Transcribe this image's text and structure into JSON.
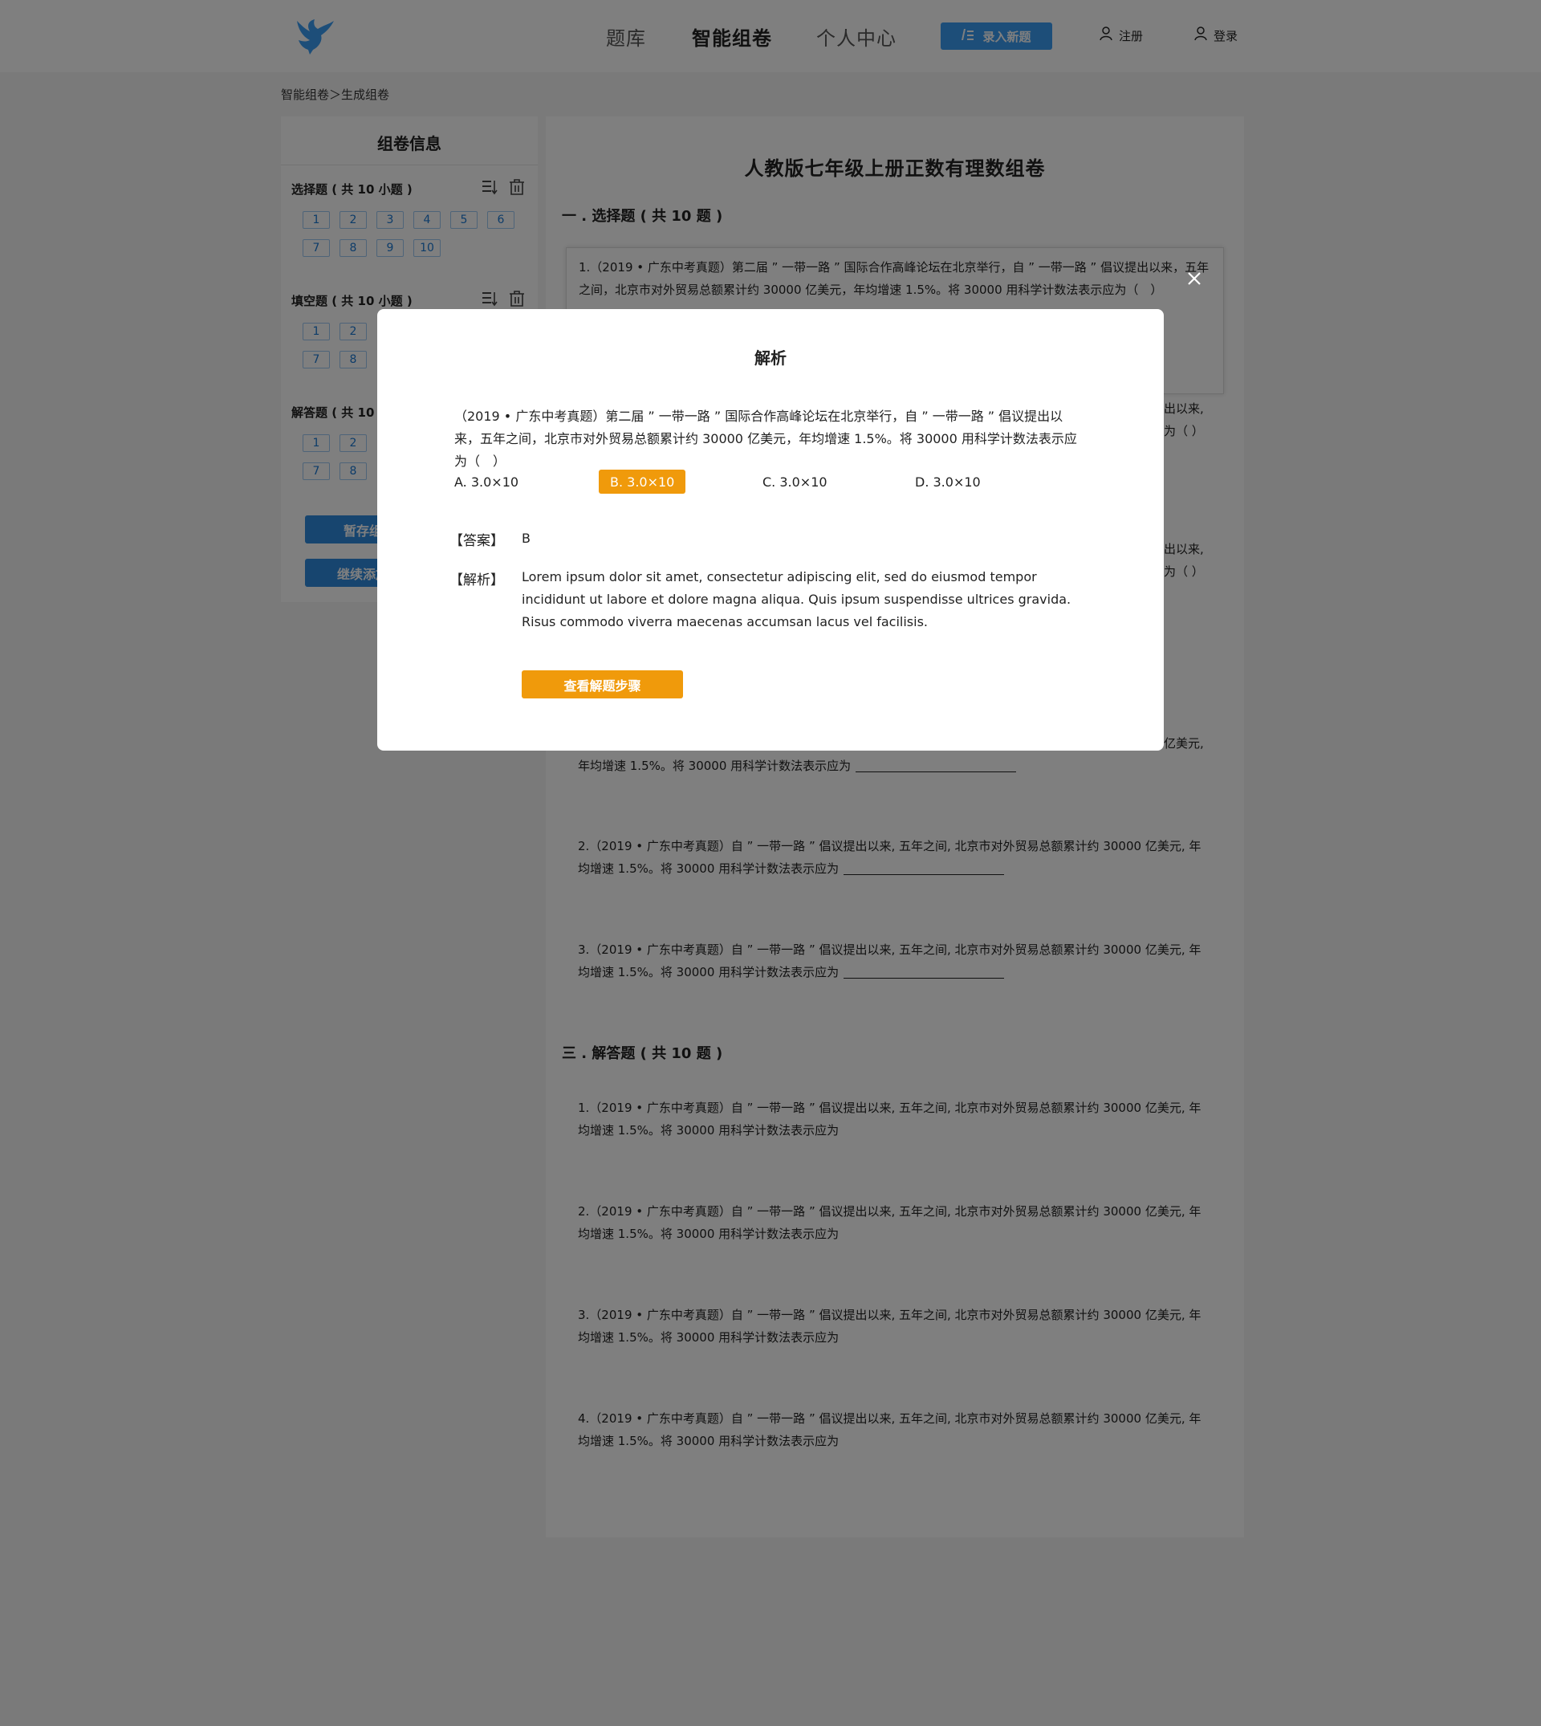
{
  "nav": {
    "items": [
      "题库",
      "智能组卷",
      "个人中心"
    ],
    "new_question": "录入新题",
    "register": "注册",
    "login": "登录"
  },
  "breadcrumb": "智能组卷＞生成组卷",
  "sidebar": {
    "title": "组卷信息",
    "sections": [
      {
        "heading": "选择题 ( 共 10 小题 )",
        "numbers": [
          "1",
          "2",
          "3",
          "4",
          "5",
          "6",
          "7",
          "8",
          "9",
          "10"
        ]
      },
      {
        "heading": "填空题 ( 共 10 小题 )",
        "numbers": [
          "1",
          "2",
          "7",
          "8"
        ]
      },
      {
        "heading": "解答题 ( 共 10",
        "numbers": [
          "1",
          "2",
          "7",
          "8"
        ]
      }
    ],
    "save_button": "暂存组卷",
    "add_button": "继续添加题"
  },
  "paper": {
    "title": "人教版七年级上册正数有理数组卷",
    "part1_heading": "一 . 选择题 ( 共 10 题 )",
    "card_q1": "1.（2019 • 广东中考真题）第二届 ” 一带一路 ” 国际合作高峰论坛在北京举行，自 ” 一带一路 ” 倡议提出以来，五年之间，北京市对外贸易总额累计约 30000 亿美元，年均增速 1.5%。将 30000 用科学计数法表示应为（　）",
    "partial_q_right_1": "出以来,",
    "partial_q_right_2": "为（ ）",
    "partial_q_right_3": "出以来,",
    "partial_q_right_4": "为（ ）",
    "fill_q1_tail": "亿美元,",
    "fill_q1_line2": "年均增速 1.5%。将 30000 用科学计数法表示应为",
    "fill_questions": [
      "2.（2019 • 广东中考真题）自 ” 一带一路 ” 倡议提出以来, 五年之间, 北京市对外贸易总额累计约 30000 亿美元, 年均增速 1.5%。将 30000 用科学计数法表示应为",
      "3.（2019 • 广东中考真题）自 ” 一带一路 ” 倡议提出以来, 五年之间, 北京市对外贸易总额累计约 30000 亿美元, 年均增速 1.5%。将 30000 用科学计数法表示应为"
    ],
    "part3_heading": "三 . 解答题 ( 共 10 题 )",
    "answer_questions": [
      "1.（2019 • 广东中考真题）自 ” 一带一路 ” 倡议提出以来, 五年之间, 北京市对外贸易总额累计约 30000 亿美元, 年均增速 1.5%。将 30000 用科学计数法表示应为",
      "2.（2019 • 广东中考真题）自 ” 一带一路 ” 倡议提出以来, 五年之间, 北京市对外贸易总额累计约 30000 亿美元, 年均增速 1.5%。将 30000 用科学计数法表示应为",
      "3.（2019 • 广东中考真题）自 ” 一带一路 ” 倡议提出以来, 五年之间, 北京市对外贸易总额累计约 30000 亿美元, 年均增速 1.5%。将 30000 用科学计数法表示应为",
      "4.（2019 • 广东中考真题）自 ” 一带一路 ” 倡议提出以来, 五年之间, 北京市对外贸易总额累计约 30000 亿美元, 年均增速 1.5%。将 30000 用科学计数法表示应为"
    ]
  },
  "modal": {
    "title": "解析",
    "question": "（2019 • 广东中考真题）第二届 ” 一带一路 ” 国际合作高峰论坛在北京举行，自 ” 一带一路 ” 倡议提出以来，五年之间，北京市对外贸易总额累计约 30000 亿美元，年均增速 1.5%。将 30000 用科学计数法表示应为（　）",
    "options": [
      "A.  3.0×10",
      "B.  3.0×10",
      "C.  3.0×10",
      "D.  3.0×10"
    ],
    "selected_option": "B",
    "answer_label": "【答案】",
    "answer_value": "B",
    "analysis_label": "【解析】",
    "analysis_text": "Lorem ipsum dolor sit amet, consectetur adipiscing elit, sed do eiusmod tempor incididunt ut labore et dolore magna aliqua. Quis ipsum suspendisse ultrices gravida. Risus commodo viverra maecenas accumsan lacus vel facilisis.",
    "steps_button": "查看解题步骤"
  },
  "colors": {
    "accent_blue": "#3a9cf2",
    "accent_orange": "#f09a0b"
  }
}
